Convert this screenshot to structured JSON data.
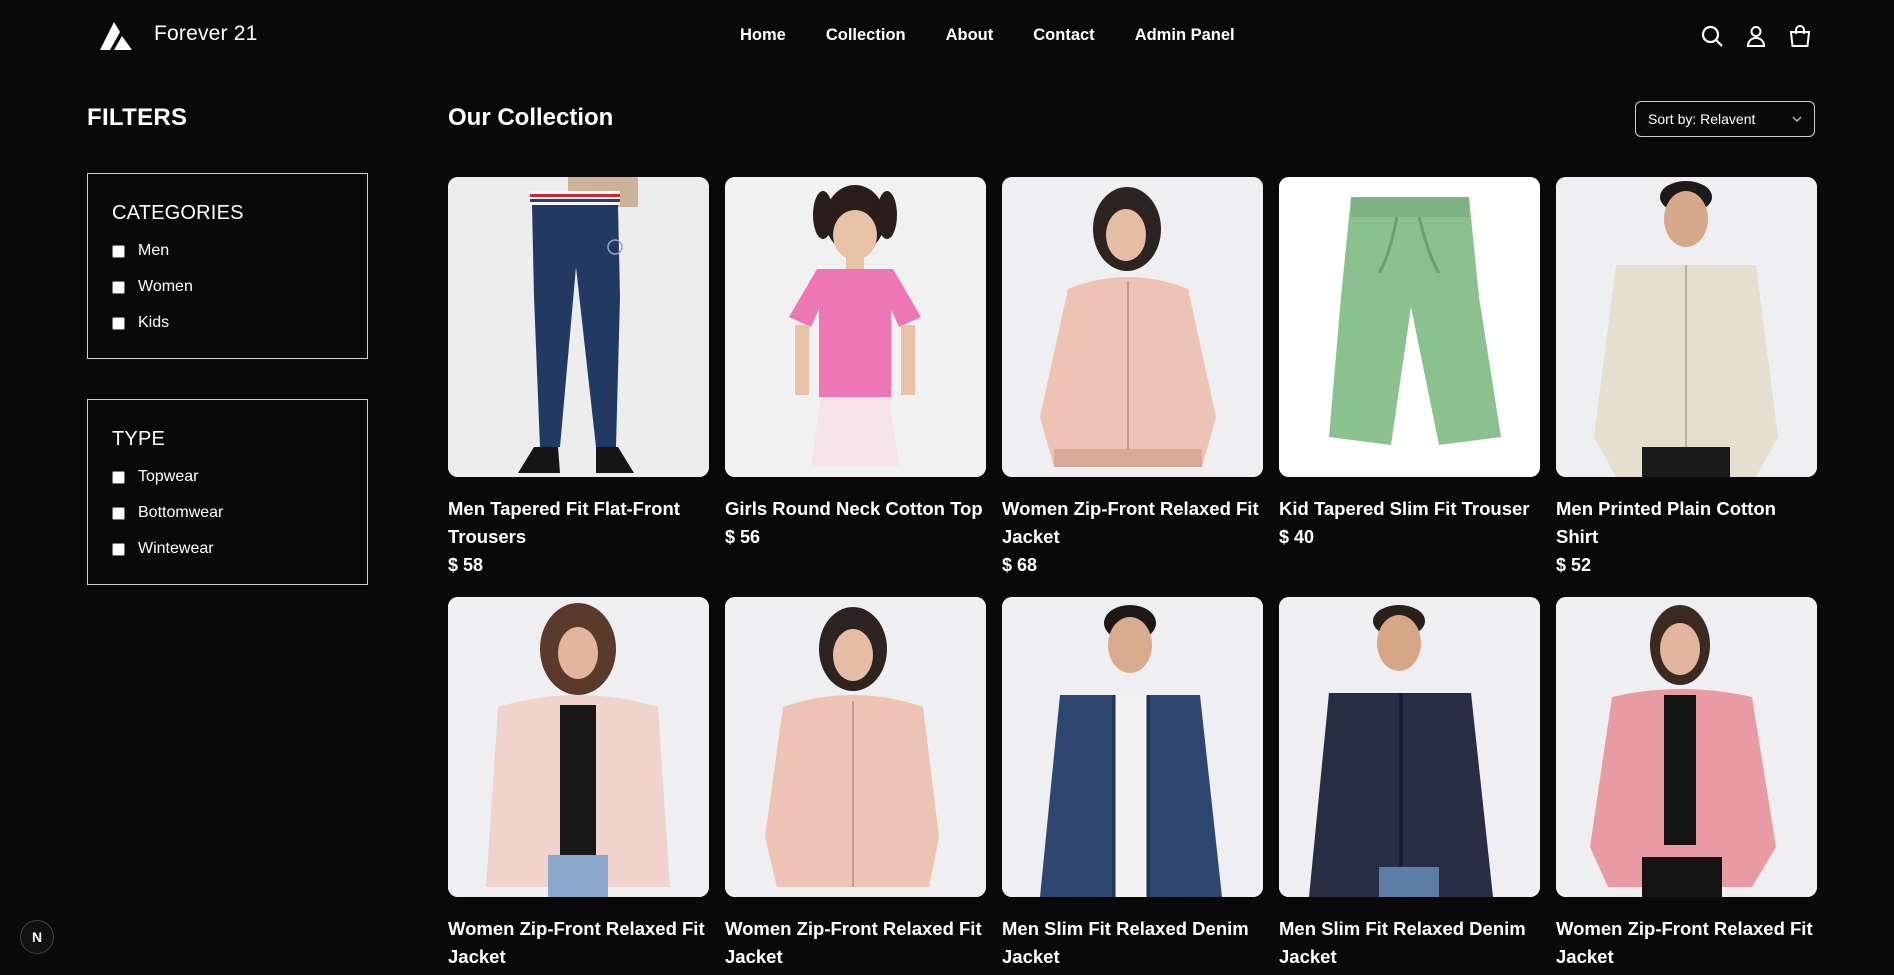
{
  "header": {
    "brand": "Forever 21",
    "nav": [
      "Home",
      "Collection",
      "About",
      "Contact",
      "Admin Panel"
    ],
    "icons": [
      "search-icon",
      "user-icon",
      "cart-icon"
    ]
  },
  "filters": {
    "title": "FILTERS",
    "categories": {
      "heading": "CATEGORIES",
      "options": [
        "Men",
        "Women",
        "Kids"
      ]
    },
    "type": {
      "heading": "TYPE",
      "options": [
        "Topwear",
        "Bottomwear",
        "Wintewear"
      ]
    }
  },
  "main": {
    "title": "Our Collection",
    "sort_label": "Sort by: Relavent"
  },
  "products": [
    {
      "name": "Men Tapered Fit Flat-Front Trousers",
      "price": "$ 58"
    },
    {
      "name": "Girls Round Neck Cotton Top",
      "price": "$ 56"
    },
    {
      "name": "Women Zip-Front Relaxed Fit Jacket",
      "price": "$ 68"
    },
    {
      "name": "Kid Tapered Slim Fit Trouser",
      "price": "$ 40"
    },
    {
      "name": "Men Printed Plain Cotton Shirt",
      "price": "$ 52"
    },
    {
      "name": "Women Zip-Front Relaxed Fit Jacket",
      "price": ""
    },
    {
      "name": "Women Zip-Front Relaxed Fit Jacket",
      "price": ""
    },
    {
      "name": "Men Slim Fit Relaxed Denim Jacket",
      "price": ""
    },
    {
      "name": "Men Slim Fit Relaxed Denim Jacket",
      "price": ""
    },
    {
      "name": "Women Zip-Front Relaxed Fit Jacket",
      "price": ""
    }
  ],
  "badge": "N"
}
